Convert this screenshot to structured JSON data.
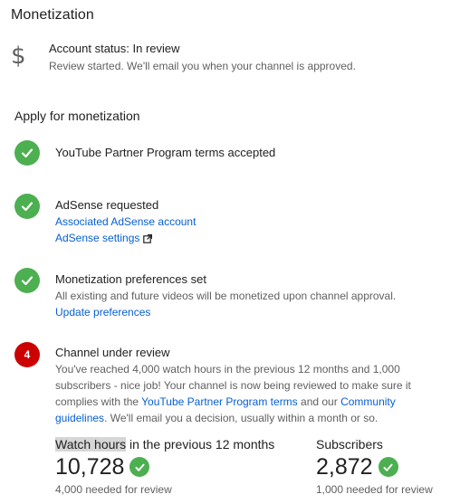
{
  "page": {
    "title": "Monetization"
  },
  "account_status": {
    "icon": "dollar-icon",
    "title": "Account status: In review",
    "subtitle": "Review started. We'll email you when your channel is approved."
  },
  "apply": {
    "title": "Apply for monetization",
    "steps": [
      {
        "state": "done",
        "title": "YouTube Partner Program terms accepted"
      },
      {
        "state": "done",
        "title": "AdSense requested",
        "links": [
          "Associated AdSense account",
          "AdSense settings"
        ]
      },
      {
        "state": "done",
        "title": "Monetization preferences set",
        "text": "All existing and future videos will be monetized upon channel approval.",
        "links": [
          "Update preferences"
        ]
      },
      {
        "state": "active",
        "number": "4",
        "title": "Channel under review",
        "text_part1": "You've reached 4,000 watch hours in the previous 12 months and 1,000 subscribers - nice job! Your channel is now being reviewed to make sure it complies with the ",
        "link1": "YouTube Partner Program terms",
        "text_part2": " and our ",
        "link2": "Community guidelines",
        "text_part3": ". We'll email you a decision, usually within a month or so."
      }
    ]
  },
  "stats": {
    "watch_hours": {
      "label_highlight": "Watch hours",
      "label_rest": " in the previous 12 months",
      "value": "10,728",
      "needed": "4,000 needed for review"
    },
    "subscribers": {
      "label": "Subscribers",
      "value": "2,872",
      "needed": "1,000 needed for review"
    }
  },
  "colors": {
    "check_green": "#4caf50",
    "active_red": "#cc0000",
    "link_blue": "#065fd4"
  }
}
